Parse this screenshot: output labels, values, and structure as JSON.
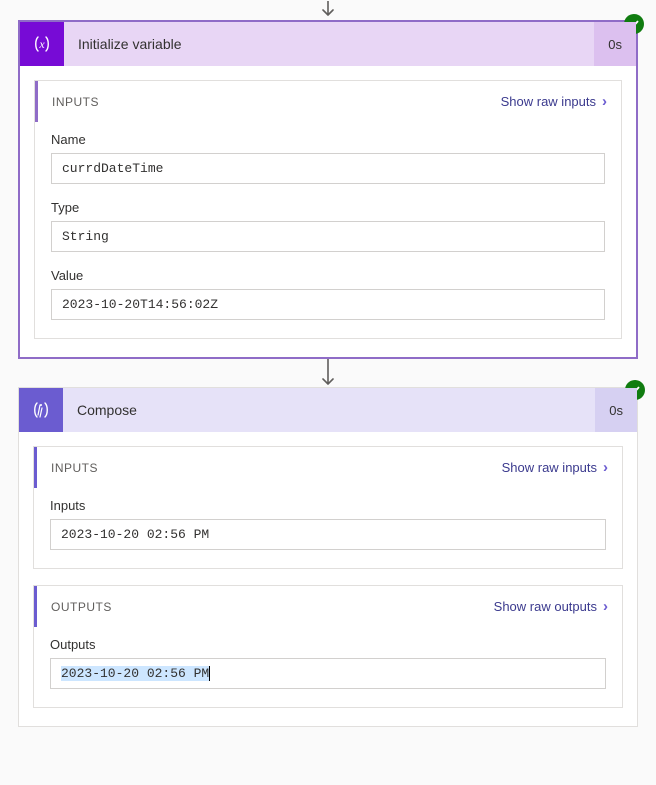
{
  "actions": {
    "initVar": {
      "title": "Initialize variable",
      "duration": "0s",
      "inputs_label": "INPUTS",
      "show_raw_inputs": "Show raw inputs",
      "fields": {
        "name_label": "Name",
        "name_value": "currdDateTime",
        "type_label": "Type",
        "type_value": "String",
        "value_label": "Value",
        "value_value": "2023-10-20T14:56:02Z"
      }
    },
    "compose": {
      "title": "Compose",
      "duration": "0s",
      "inputs_label": "INPUTS",
      "show_raw_inputs": "Show raw inputs",
      "inputs": {
        "label": "Inputs",
        "value": "2023-10-20 02:56 PM"
      },
      "outputs_label": "OUTPUTS",
      "show_raw_outputs": "Show raw outputs",
      "outputs": {
        "label": "Outputs",
        "value": "2023-10-20 02:56 PM"
      }
    }
  }
}
